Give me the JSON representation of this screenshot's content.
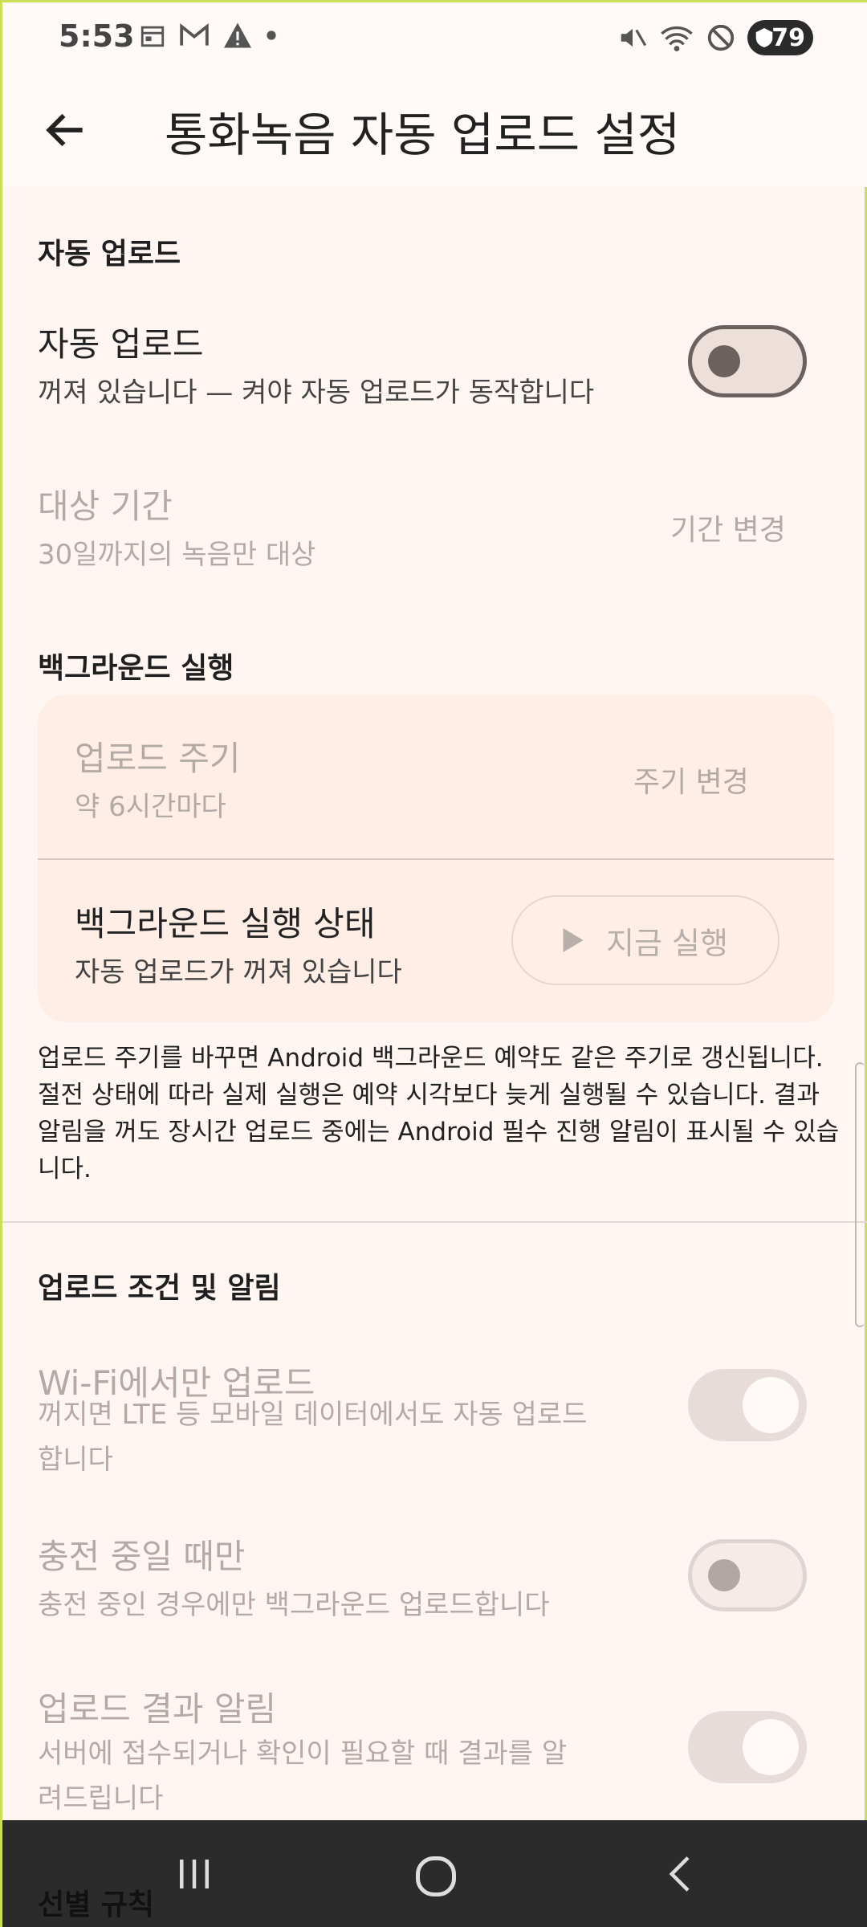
{
  "status": {
    "time": "5:53",
    "battery": "79"
  },
  "header": {
    "title": "통화녹음 자동 업로드 설정"
  },
  "auto_upload_section": {
    "heading": "자동 업로드",
    "toggle": {
      "title": "자동 업로드",
      "subtitle": "꺼져 있습니다 — 켜야 자동 업로드가 동작합니다",
      "on": false
    },
    "period": {
      "title": "대상 기간",
      "subtitle": "30일까지의 녹음만 대상",
      "action": "기간 변경"
    }
  },
  "background_section": {
    "heading": "백그라운드 실행",
    "cycle": {
      "title": "업로드 주기",
      "subtitle": "약 6시간마다",
      "action": "주기 변경"
    },
    "state": {
      "title": "백그라운드 실행 상태",
      "subtitle": "자동 업로드가 꺼져 있습니다",
      "run_label": "지금 실행"
    },
    "note": "업로드 주기를 바꾸면 Android 백그라운드 예약도 같은 주기로 갱신됩니다. 절전 상태에 따라 실제 실행은 예약 시각보다 늦게 실행될 수 있습니다. 결과 알림을 꺼도 장시간 업로드 중에는 Android 필수 진행 알림이 표시될 수 있습니다."
  },
  "conditions_section": {
    "heading": "업로드 조건 및 알림",
    "wifi": {
      "title": "Wi-Fi에서만 업로드",
      "subtitle_1": "꺼지면 LTE 등 모바일 데이터에서도 자동 업로드",
      "subtitle_2": "합니다",
      "on": true
    },
    "charging": {
      "title": "충전 중일 때만",
      "subtitle": "충전 중인 경우에만 백그라운드 업로드합니다",
      "on": false
    },
    "notify": {
      "title": "업로드 결과 알림",
      "subtitle_1": "서버에 접수되거나 확인이 필요할 때 결과를 알",
      "subtitle_2": "려드립니다",
      "on": true
    }
  },
  "next_section": {
    "heading": "선별 규칙"
  },
  "nav": {
    "recent": "recents-icon",
    "home": "home-icon",
    "back": "back-icon"
  }
}
